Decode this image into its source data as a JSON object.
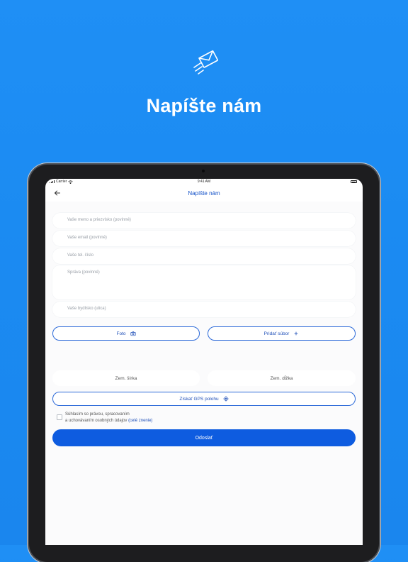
{
  "hero": {
    "title": "Napíšte nám",
    "icon": "envelope-send-icon"
  },
  "status_bar": {
    "carrier": "Carrier",
    "time": "9:41 AM"
  },
  "navbar": {
    "title": "Napíšte nám",
    "back_icon": "back-arrow-icon"
  },
  "form": {
    "name_placeholder": "Vaše meno a priezvisko (povinné)",
    "email_placeholder": "Vaše email (povinné)",
    "phone_placeholder": "Vaše tel. číslo",
    "message_placeholder": "Správa (povinné)",
    "address_placeholder": "Vaše bydlisko (ulica)",
    "photo_label": "Foto",
    "add_file_label": "Pridať súbor",
    "latitude_label": "Zem. šírka",
    "longitude_label": "Zem. dĺžka",
    "gps_label": "Získať GPS polohu",
    "consent_line1": "Súhlasím so právou, spracovaním",
    "consent_line2": "a uchovávaním osobných údajov ",
    "consent_link": "(celé znenie)",
    "submit_label": "Odoslať"
  },
  "colors": {
    "accent": "#0e5ce0",
    "background": "#1f8ff5",
    "link": "#1f4fb8"
  }
}
